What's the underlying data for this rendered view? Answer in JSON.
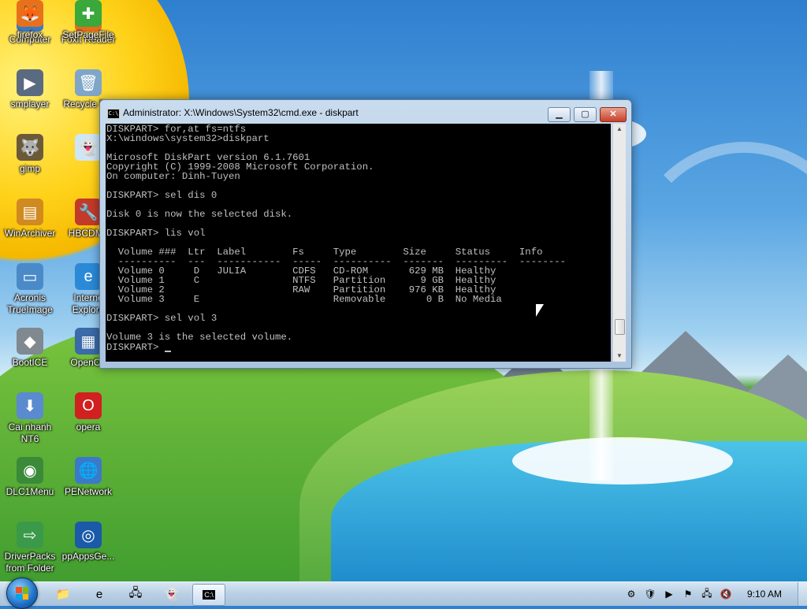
{
  "desktop": {
    "icons": [
      {
        "label": "Computer",
        "icon": "computer-icon",
        "glyph": "🖥",
        "color": "#3a78c8"
      },
      {
        "label": "Foxit Reader",
        "icon": "pdf-icon",
        "glyph": "PDF",
        "color": "#e86a1c"
      },
      {
        "label": "smplayer",
        "icon": "smplayer-icon",
        "glyph": "▶",
        "color": "#5a6a80"
      },
      {
        "label": "Recycle Bin",
        "icon": "recycle-bin-icon",
        "glyph": "🗑",
        "color": "#7fa6c8"
      },
      {
        "label": "gimp",
        "icon": "gimp-icon",
        "glyph": "🐺",
        "color": "#6b5a3a"
      },
      {
        "label": "",
        "icon": "ghost-icon",
        "glyph": "👻",
        "color": "#cfe6f6"
      },
      {
        "label": "WinArchiver",
        "icon": "archive-icon",
        "glyph": "▤",
        "color": "#d08a20"
      },
      {
        "label": "HBCDMe",
        "icon": "tools-icon",
        "glyph": "🔧",
        "color": "#c23a2a"
      },
      {
        "label": "Acronis\nTrueImage",
        "icon": "acronis-icon",
        "glyph": "▭",
        "color": "#4a8ac8"
      },
      {
        "label": "Interne\nExplore",
        "icon": "internet-explorer-icon",
        "glyph": "e",
        "color": "#2a8ad8"
      },
      {
        "label": "BootICE",
        "icon": "bootice-icon",
        "glyph": "◆",
        "color": "#808890"
      },
      {
        "label": "OpenOff",
        "icon": "openoffice-icon",
        "glyph": "▦",
        "color": "#3a6aa8"
      },
      {
        "label": "Cai nhanh\nNT6",
        "icon": "install-icon",
        "glyph": "⬇",
        "color": "#5a8ad0"
      },
      {
        "label": "opera",
        "icon": "opera-icon",
        "glyph": "O",
        "color": "#d02020"
      },
      {
        "label": "DLC1Menu",
        "icon": "dlc-icon",
        "glyph": "◉",
        "color": "#3a8a3a"
      },
      {
        "label": "PENetwork",
        "icon": "network-icon",
        "glyph": "🌐",
        "color": "#3a7ac8"
      },
      {
        "label": "DriverPacks\nfrom Folder",
        "icon": "driver-icon",
        "glyph": "⇨",
        "color": "#3a9a4a"
      },
      {
        "label": "ppAppsGe...",
        "icon": "ppapps-icon",
        "glyph": "◎",
        "color": "#1a5aa8"
      },
      {
        "label": "firefox",
        "icon": "firefox-icon",
        "glyph": "🦊",
        "color": "#e8701a"
      },
      {
        "label": "SetPageFile",
        "icon": "setpagefile-icon",
        "glyph": "✚",
        "color": "#3aa83a"
      }
    ]
  },
  "cmd": {
    "title": "Administrator: X:\\Windows\\System32\\cmd.exe - diskpart",
    "icon_label": "C:\\",
    "min_label": "▁",
    "max_label": "▢",
    "close_label": "✕",
    "output": "DISKPART> for,at fs=ntfs\nX:\\windows\\system32>diskpart\n\nMicrosoft DiskPart version 6.1.7601\nCopyright (C) 1999-2008 Microsoft Corporation.\nOn computer: Dinh-Tuyen\n\nDISKPART> sel dis 0\n\nDisk 0 is now the selected disk.\n\nDISKPART> lis vol\n\n  Volume ###  Ltr  Label        Fs     Type        Size     Status     Info\n  ----------  ---  -----------  -----  ----------  -------  ---------  --------\n  Volume 0     D   JULIA        CDFS   CD-ROM       629 MB  Healthy\n  Volume 1     C                NTFS   Partition      9 GB  Healthy\n  Volume 2                      RAW    Partition    976 KB  Healthy\n  Volume 3     E                       Removable       0 B  No Media\n\nDISKPART> sel vol 3\n\nVolume 3 is the selected volume.\n",
    "prompt": "DISKPART> "
  },
  "taskbar": {
    "pinned": [
      {
        "name": "explorer",
        "glyph": "📁"
      },
      {
        "name": "internet-explorer",
        "glyph": "e"
      },
      {
        "name": "network",
        "glyph": "🖧"
      },
      {
        "name": "ghost",
        "glyph": "👻"
      },
      {
        "name": "cmd",
        "glyph": "C:\\"
      }
    ],
    "tray": [
      "⚙",
      "🛡",
      "▶",
      "⚑",
      "🖧",
      "🔇"
    ],
    "clock": "9:10 AM"
  }
}
